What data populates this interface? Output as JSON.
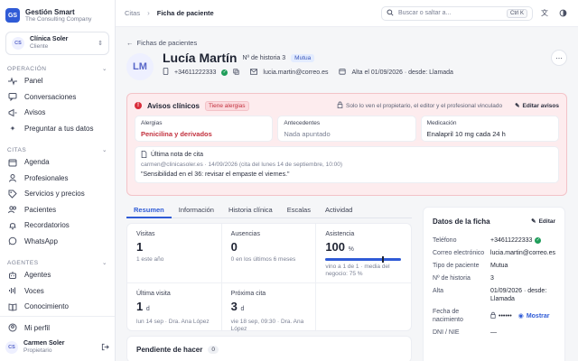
{
  "sidebar": {
    "brand_logo": "GS",
    "brand_name": "Gestión Smart",
    "brand_sub": "The Consulting Company",
    "client_initials": "CS",
    "client_name": "Clínica Soler",
    "client_role": "Cliente",
    "sections": [
      {
        "title": "OPERACIÓN",
        "items": [
          {
            "label": "Panel",
            "icon": "pulse-icon"
          },
          {
            "label": "Conversaciones",
            "icon": "chat-icon"
          },
          {
            "label": "Avisos",
            "icon": "megaphone-icon"
          },
          {
            "label": "Preguntar a tus datos",
            "icon": "sparkle-icon"
          }
        ]
      },
      {
        "title": "CITAS",
        "items": [
          {
            "label": "Agenda",
            "icon": "calendar-icon"
          },
          {
            "label": "Profesionales",
            "icon": "people-icon"
          },
          {
            "label": "Servicios y precios",
            "icon": "tag-icon"
          },
          {
            "label": "Pacientes",
            "icon": "users-icon"
          },
          {
            "label": "Recordatorios",
            "icon": "bell-icon"
          },
          {
            "label": "WhatsApp",
            "icon": "whatsapp-icon"
          }
        ]
      },
      {
        "title": "AGENTES",
        "items": [
          {
            "label": "Agentes",
            "icon": "bot-icon"
          },
          {
            "label": "Voces",
            "icon": "waveform-icon"
          },
          {
            "label": "Conocimiento",
            "icon": "book-icon"
          }
        ]
      }
    ],
    "profile_label": "Mi perfil",
    "user_initials": "CS",
    "user_name": "Carmen Soler",
    "user_role": "Propietario"
  },
  "topbar": {
    "crumb_root": "Citas",
    "crumb_current": "Ficha de paciente",
    "search_placeholder": "Buscar o saltar a...",
    "search_kbd": "Ctrl K"
  },
  "patient": {
    "back_label": "Fichas de pacientes",
    "initials": "LM",
    "name": "Lucía Martín",
    "history_label": "Nº de historia 3",
    "badge": "Mutua",
    "phone": "+34611222333",
    "email": "lucia.martin@correo.es",
    "since": "Alta el 01/09/2026 · desde: Llamada"
  },
  "alerts": {
    "title": "Avisos clínicos",
    "badge": "Tiene alergias",
    "note": "Solo lo ven el propietario, el editor y el profesional vinculado",
    "edit_label": "Editar avisos",
    "cards": [
      {
        "label": "Alergias",
        "value": "Penicilina y derivados",
        "style": "red"
      },
      {
        "label": "Antecedentes",
        "value": "Nada apuntado",
        "style": "muted"
      },
      {
        "label": "Medicación",
        "value": "Enalapril 10 mg cada 24 h",
        "style": "normal"
      }
    ],
    "last_note_title": "Última nota de cita",
    "last_note_meta": "carmen@clinicasoler.es · 14/09/2026 (cita del lunes 14 de septiembre, 10:00)",
    "last_note_text": "\"Sensibilidad en el 36: revisar el empaste el viernes.\""
  },
  "tabs": [
    "Resumen",
    "Información",
    "Historia clínica",
    "Escalas",
    "Actividad"
  ],
  "stats": {
    "visits_label": "Visitas",
    "visits_value": "1",
    "visits_sub": "1 este año",
    "absences_label": "Ausencias",
    "absences_value": "0",
    "absences_sub": "0 en los últimos 6 meses",
    "attendance_label": "Asistencia",
    "attendance_value": "100",
    "attendance_unit": "%",
    "attendance_fraction": 1.0,
    "attendance_median": 0.75,
    "attendance_sub": "vino a 1 de 1 · media del negocio: 75 %",
    "last_visit_label": "Última visita",
    "last_visit_value": "1",
    "last_visit_unit": "d",
    "last_visit_sub": "lun 14 sep · Dra. Ana López",
    "next_label": "Próxima cita",
    "next_value": "3",
    "next_unit": "d",
    "next_sub": "vie 18 sep, 09:30 · Dra. Ana López"
  },
  "pending": {
    "title": "Pendiente de hacer",
    "count": "0"
  },
  "record": {
    "title": "Datos de la ficha",
    "edit_label": "Editar",
    "rows": [
      {
        "k": "Teléfono",
        "v": "+34611222333"
      },
      {
        "k": "Correo electrónico",
        "v": "lucia.martin@correo.es"
      },
      {
        "k": "Tipo de paciente",
        "v": "Mutua"
      },
      {
        "k": "Nº de historia",
        "v": "3"
      },
      {
        "k": "Alta",
        "v": "01/09/2026 · desde: Llamada"
      },
      {
        "k": "Fecha de nacimiento",
        "v": "••••••"
      },
      {
        "k": "DNI / NIE",
        "v": "—"
      }
    ],
    "show_label": "Mostrar"
  }
}
